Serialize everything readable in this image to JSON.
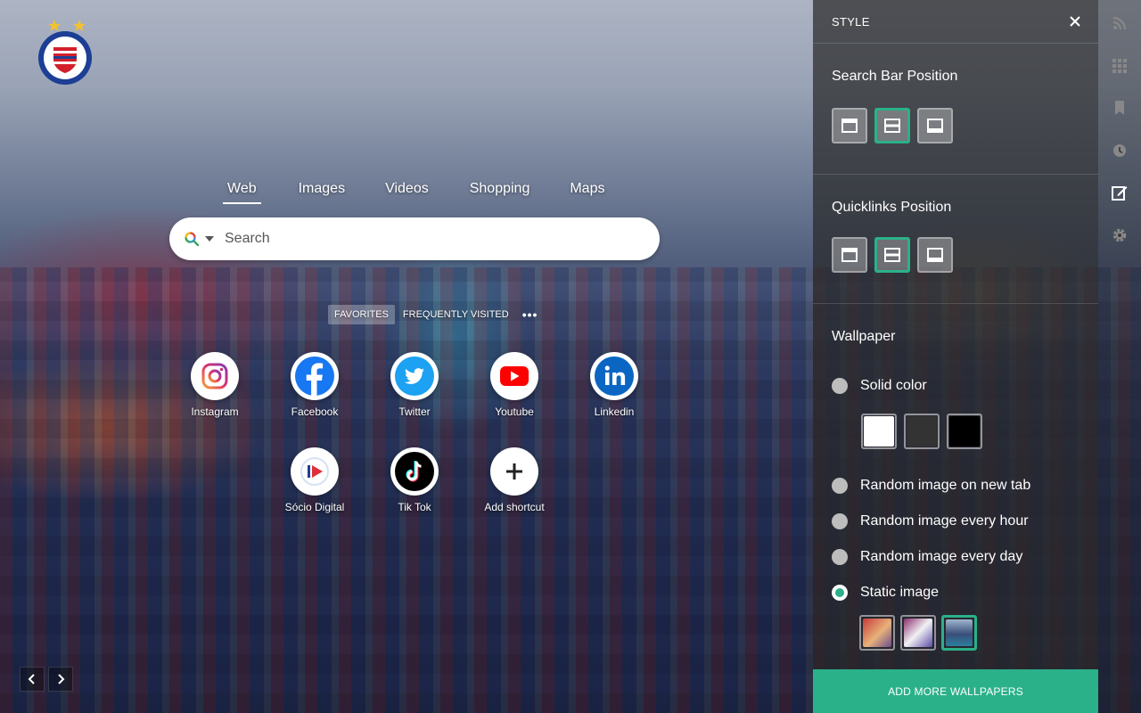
{
  "search": {
    "tabs": [
      "Web",
      "Images",
      "Videos",
      "Shopping",
      "Maps"
    ],
    "active_tab": "Web",
    "placeholder": "Search"
  },
  "quicklinks": {
    "tabs": [
      "FAVORITES",
      "FREQUENTLY VISITED"
    ],
    "active_tab": "FAVORITES",
    "more": "•••",
    "items": [
      {
        "label": "Instagram",
        "icon": "instagram-icon"
      },
      {
        "label": "Facebook",
        "icon": "facebook-icon"
      },
      {
        "label": "Twitter",
        "icon": "twitter-icon"
      },
      {
        "label": "Youtube",
        "icon": "youtube-icon"
      },
      {
        "label": "Linkedin",
        "icon": "linkedin-icon"
      },
      {
        "label": "Sócio Digital",
        "icon": "socio-digital-icon"
      },
      {
        "label": "Tik Tok",
        "icon": "tiktok-icon"
      },
      {
        "label": "Add shortcut",
        "icon": "plus-icon"
      }
    ]
  },
  "panel": {
    "title": "STYLE",
    "search_bar_position": {
      "title": "Search Bar Position",
      "options": [
        "top",
        "middle",
        "bottom"
      ],
      "selected": "middle"
    },
    "quicklinks_position": {
      "title": "Quicklinks Position",
      "options": [
        "top",
        "middle",
        "bottom"
      ],
      "selected": "middle"
    },
    "wallpaper": {
      "title": "Wallpaper",
      "solid_color": "Solid color",
      "colors": [
        "#ffffff",
        "#333333",
        "#000000"
      ],
      "random_new_tab": "Random image on new tab",
      "random_hour": "Random image every hour",
      "random_day": "Random image every day",
      "static_image": "Static image",
      "selected": "Static image",
      "thumbnails": 3,
      "selected_thumbnail": 3
    },
    "add_more": "ADD MORE WALLPAPERS"
  },
  "rail": [
    "rss-icon",
    "apps-grid-icon",
    "bookmark-icon",
    "history-clock-icon",
    "edit-style-icon",
    "settings-gear-icon"
  ],
  "colors": {
    "accent": "#2bb18a",
    "panel_bg": "rgba(40,40,40,0.72)"
  }
}
